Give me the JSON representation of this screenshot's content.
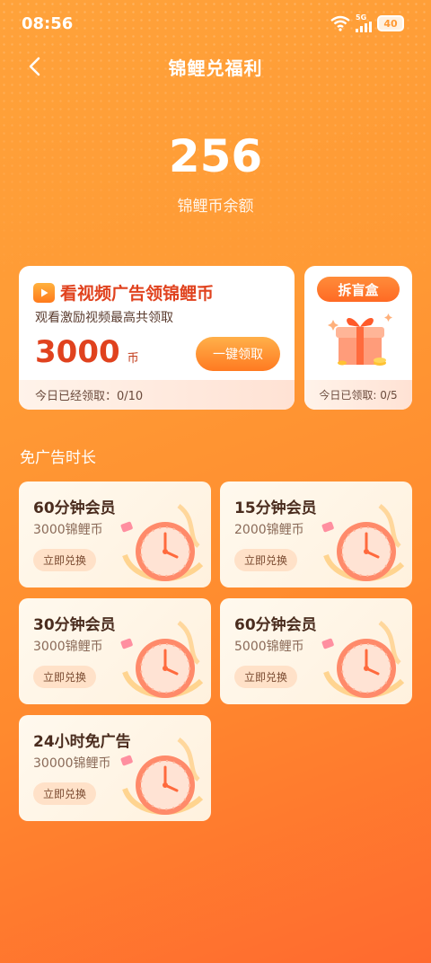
{
  "status_bar": {
    "time": "08:56",
    "network": "5G",
    "battery": "40"
  },
  "header": {
    "title": "锦鲤兑福利"
  },
  "balance": {
    "value": "256",
    "label": "锦鲤币余额"
  },
  "video_card": {
    "title": "看视频广告领锦鲤币",
    "subtitle": "观看激励视频最高共领取",
    "amount": "3000",
    "unit": "币",
    "button": "一键领取",
    "progress_text": "今日已经领取：0/10"
  },
  "blind_box": {
    "button": "拆盲盒",
    "progress_text": "今日已领取: 0/5"
  },
  "section_title": "免广告时长",
  "memberships": [
    {
      "name": "60分钟会员",
      "price": "3000锦鲤币",
      "button": "立即兑换"
    },
    {
      "name": "15分钟会员",
      "price": "2000锦鲤币",
      "button": "立即兑换"
    },
    {
      "name": "30分钟会员",
      "price": "3000锦鲤币",
      "button": "立即兑换"
    },
    {
      "name": "60分钟会员",
      "price": "5000锦鲤币",
      "button": "立即兑换"
    },
    {
      "name": "24小时免广告",
      "price": "30000锦鲤币",
      "button": "立即兑换"
    }
  ],
  "colors": {
    "accent": "#e0421e",
    "gradient_top": "#ffa23a",
    "gradient_bottom": "#ff6a2f"
  }
}
